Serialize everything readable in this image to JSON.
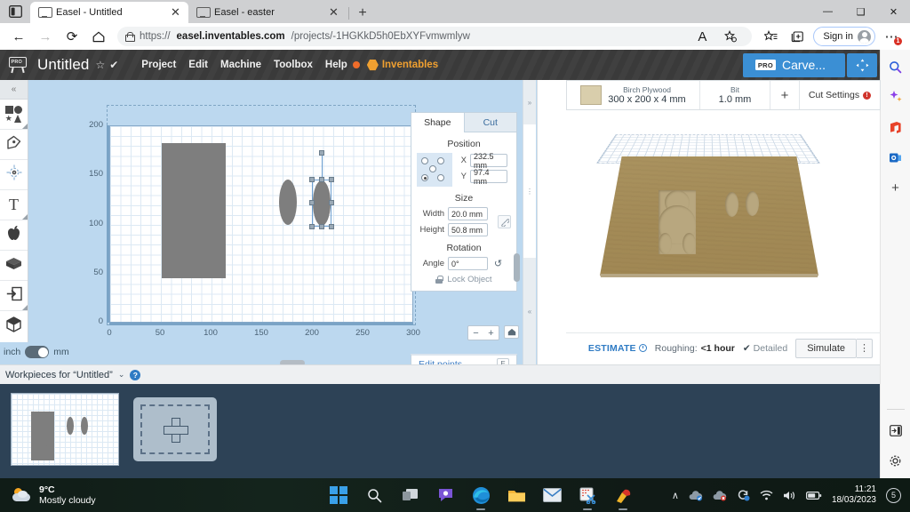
{
  "browser": {
    "tabs": [
      {
        "title": "Easel - Untitled",
        "active": true,
        "icon": "easel-favicon",
        "close": "✕"
      },
      {
        "title": "Easel - easter",
        "active": false,
        "icon": "easel-favicon",
        "close": "✕"
      }
    ],
    "new_tab_label": "+",
    "tab_list_icon": "tab-list-icon",
    "nav": {
      "back": "←",
      "forward": "→",
      "refresh": "⟳",
      "home": "⌂"
    },
    "url_prefix": "https://",
    "url_domain": "easel.inventables.com",
    "url_path": "/projects/-1HGKkD5h0EbXYFvmwmlyw",
    "read_aloud_icon": "A",
    "collections_icon": "collections-icon",
    "favorites_icon": "favorites-icon",
    "split_icon": "split-screen-icon",
    "sign_in_label": "Sign in",
    "more_icon": "⋯",
    "more_badge": "1",
    "window": {
      "minimize": "—",
      "maximize": "❑",
      "close": "✕"
    }
  },
  "edge_sidebar": {
    "items": [
      {
        "name": "search-icon",
        "glyph": "🔍"
      },
      {
        "name": "copilot-icon",
        "glyph": "✦"
      },
      {
        "name": "office-icon",
        "glyph": "◗"
      },
      {
        "name": "outlook-icon",
        "glyph": "▣"
      },
      {
        "name": "add-app-icon",
        "glyph": "+"
      }
    ],
    "bottom": [
      {
        "name": "customize-sidebar-icon",
        "glyph": "⬒"
      },
      {
        "name": "settings-gear-icon",
        "glyph": "⚙"
      }
    ]
  },
  "easel": {
    "logo_text": "PRO",
    "project_title": "Untitled",
    "star_icon": "☆",
    "saved_icon": "✔",
    "menus": [
      "Project",
      "Edit",
      "Machine",
      "Toolbox",
      "Help"
    ],
    "help_badge_color": "#ef6c2a",
    "inventables_label": "Inventables",
    "carve_button": {
      "badge": "PRO",
      "label": "Carve..."
    },
    "fullscreen_icon": "✧"
  },
  "toolbar": {
    "collapse_icon": "«",
    "tools": [
      {
        "name": "shapes-tool",
        "icon": "shapes-icon",
        "has_menu": true
      },
      {
        "name": "pen-tool",
        "icon": "pen-icon",
        "has_menu": false
      },
      {
        "name": "drill-tool",
        "icon": "drill-target-icon",
        "has_menu": false
      },
      {
        "name": "text-tool",
        "icon": "text-T-icon",
        "has_menu": true
      },
      {
        "name": "apps-tool",
        "icon": "apple-icon",
        "has_menu": false
      },
      {
        "name": "projects-tool",
        "icon": "box-icon",
        "has_menu": false
      },
      {
        "name": "import-tool",
        "icon": "import-arrow-icon",
        "has_menu": true
      },
      {
        "name": "3d-tool",
        "icon": "cube-icon",
        "has_menu": false
      }
    ],
    "units": {
      "left": "inch",
      "right": "mm",
      "selected": "mm"
    }
  },
  "canvas": {
    "y_ticks": [
      "200",
      "150",
      "100",
      "50",
      "0"
    ],
    "x_ticks": [
      "0",
      "50",
      "100",
      "150",
      "200",
      "250",
      "300"
    ],
    "zoom_out": "−",
    "zoom_in": "+",
    "home_icon": "⌂",
    "shapes": [
      {
        "name": "penguin-shape",
        "selected": false
      },
      {
        "name": "ellipse-wing-left",
        "selected": false
      },
      {
        "name": "ellipse-wing-right",
        "selected": true
      }
    ]
  },
  "properties": {
    "tabs": [
      {
        "label": "Shape",
        "active": true
      },
      {
        "label": "Cut",
        "active": false
      }
    ],
    "position": {
      "title": "Position",
      "x_label": "X",
      "x_value": "232.5 mm",
      "y_label": "Y",
      "y_value": "97.4 mm"
    },
    "size": {
      "title": "Size",
      "width_label": "Width",
      "width_value": "20.0 mm",
      "height_label": "Height",
      "height_value": "50.8 mm",
      "link_icon": "link-aspect-icon"
    },
    "rotation": {
      "title": "Rotation",
      "angle_label": "Angle",
      "angle_value": "0°",
      "reset_icon": "↺"
    },
    "lock": {
      "label": "Lock Object",
      "icon": "lock-icon"
    },
    "edit_points": {
      "label": "Edit points",
      "shortcut": "E"
    }
  },
  "preview": {
    "material": {
      "name": "Birch Plywood",
      "dimensions": "300 x 200 x 4 mm",
      "swatch_color": "#d9ceac"
    },
    "bit": {
      "label": "Bit",
      "value": "1.0 mm"
    },
    "add_label": "+",
    "cut_settings": {
      "label": "Cut Settings",
      "badge": "!"
    },
    "estimate": {
      "label": "ESTIMATE",
      "info_icon": "info-clock-icon",
      "roughing_label": "Roughing:",
      "roughing_value": "<1 hour",
      "detailed_check": "✔",
      "detailed_label": "Detailed",
      "simulate_label": "Simulate",
      "more_icon": "⋮"
    }
  },
  "workpieces": {
    "header": "Workpieces for “Untitled”",
    "chevron": "⌄",
    "help_icon": "?",
    "cards": [
      {
        "name": "workpiece-thumbnail-1",
        "selected": true
      },
      {
        "name": "workpiece-add-tile",
        "plus": "+"
      }
    ]
  },
  "taskbar": {
    "weather": {
      "temp": "9°C",
      "desc": "Mostly cloudy",
      "icon": "partly-cloudy-icon"
    },
    "pinned": [
      {
        "name": "start-button",
        "icon": "windows-logo-icon"
      },
      {
        "name": "search-taskbar-button",
        "icon": "search-icon"
      },
      {
        "name": "task-view-button",
        "icon": "task-view-icon"
      },
      {
        "name": "chat-button",
        "icon": "chat-icon"
      },
      {
        "name": "edge-button",
        "icon": "edge-icon",
        "running": true
      },
      {
        "name": "file-explorer-button",
        "icon": "folder-icon"
      },
      {
        "name": "mail-button",
        "icon": "mail-icon"
      },
      {
        "name": "snipping-tool-button",
        "icon": "snip-icon",
        "running": true
      },
      {
        "name": "ccleaner-button",
        "icon": "ccleaner-icon",
        "running": true
      }
    ],
    "tray": [
      {
        "name": "show-hidden-icons",
        "glyph": "∧"
      },
      {
        "name": "onedrive-sync-icon",
        "glyph": "☁"
      },
      {
        "name": "antivirus-icon",
        "glyph": "☁"
      },
      {
        "name": "update-icon",
        "glyph": "↻"
      },
      {
        "name": "wifi-icon",
        "glyph": "◡"
      },
      {
        "name": "volume-icon",
        "glyph": "🔊"
      },
      {
        "name": "battery-icon",
        "glyph": "▭"
      }
    ],
    "clock": {
      "time": "11:21",
      "date": "18/03/2023"
    },
    "notifications": {
      "count": "5"
    }
  }
}
